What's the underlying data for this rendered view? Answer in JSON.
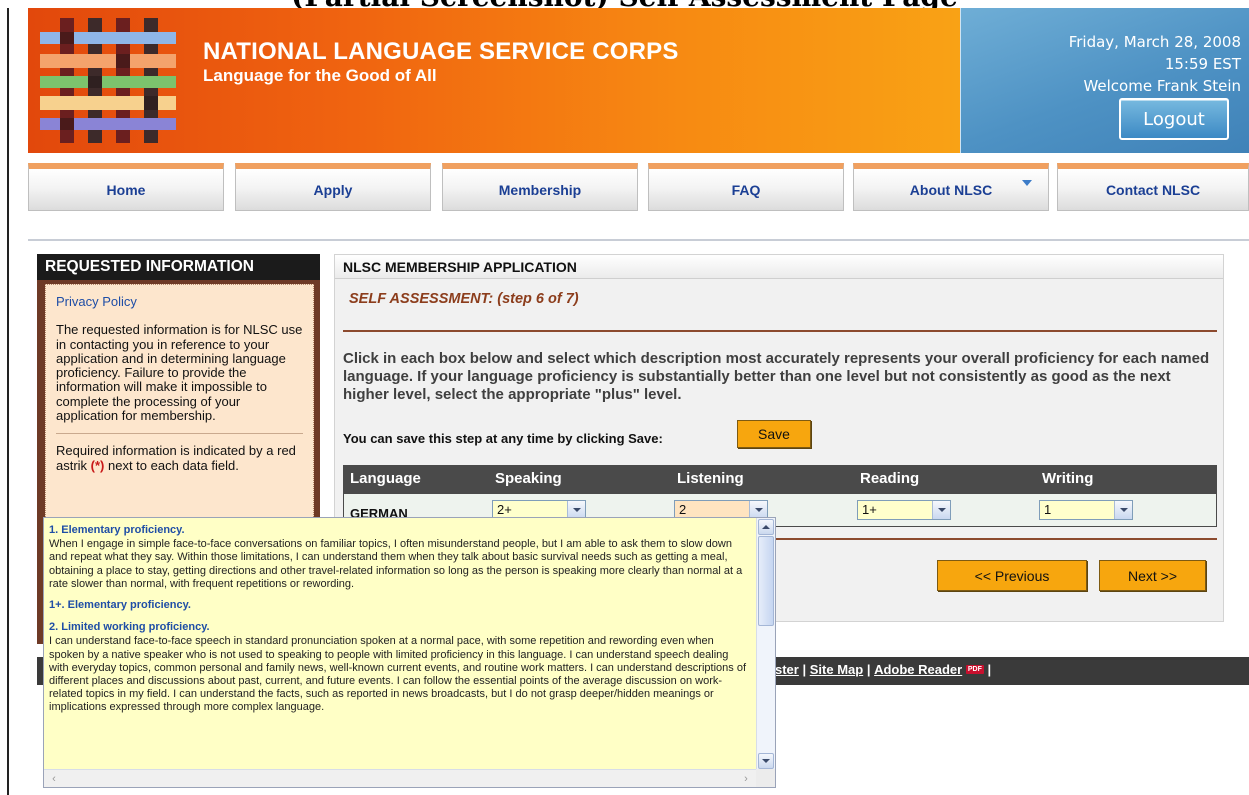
{
  "top_title": "(Partial Screenshot) Self Assessment Page",
  "header": {
    "title": "NATIONAL LANGUAGE SERVICE CORPS",
    "subtitle": "Language for the Good of All",
    "date": "Friday, March 28, 2008",
    "time": "15:59 EST",
    "welcome": "Welcome Frank Stein",
    "logout_label": "Logout",
    "colors": {
      "header_orange": "#f06410",
      "userbox_blue": "#4e92c4"
    }
  },
  "nav": {
    "items": [
      {
        "label": "Home"
      },
      {
        "label": "Apply"
      },
      {
        "label": "Membership"
      },
      {
        "label": "FAQ"
      },
      {
        "label": "About NLSC",
        "has_dropdown": true
      },
      {
        "label": "Contact NLSC"
      }
    ]
  },
  "sidebar": {
    "heading": "REQUESTED INFORMATION",
    "privacy_link": "Privacy Policy",
    "paragraph": "The requested information is for NLSC use in contacting you in reference to your application and in determining language proficiency. Failure to provide the information will make it impossible to complete the processing of your application for membership.",
    "required_text_before": "Required information is indicated by a red astrik ",
    "required_marker": "(*)",
    "required_text_after": " next to each data field."
  },
  "main": {
    "heading": "NLSC MEMBERSHIP APPLICATION",
    "step_title": "SELF ASSESSMENT: (step 6 of 7)",
    "instructions": "Click in each box below and select which description most accurately represents your overall proficiency for each named language. If your language proficiency is substantially better than one level but not consistently as good as the next higher level, select the appropriate \"plus\" level.",
    "save_prompt": "You can save this step at any time by clicking Save:",
    "save_label": "Save",
    "table": {
      "headers": [
        "Language",
        "Speaking",
        "Listening",
        "Reading",
        "Writing"
      ],
      "rows": [
        {
          "language": "GERMAN",
          "speaking": "2+",
          "listening": "2",
          "reading": "1+",
          "writing": "1"
        }
      ]
    },
    "prev_label": "<< Previous",
    "next_label": "Next >>"
  },
  "footer": {
    "links": [
      "ster",
      "Site Map",
      "Adobe Reader"
    ],
    "pdf_badge": "PDF"
  },
  "dropdown": {
    "options": [
      {
        "title": "1. Elementary proficiency.",
        "description": "When I engage in simple face-to-face conversations on familiar topics, I often misunderstand people, but I am able to ask them to slow down and repeat what they say. Within those limitations, I can understand them when they talk about basic survival needs such as getting a meal, obtaining a place to stay, getting directions and other travel-related information so long as the person is speaking more clearly than normal at a rate slower than normal, with frequent repetitions or rewording."
      },
      {
        "title": "1+. Elementary proficiency.",
        "description": ""
      },
      {
        "title": "2. Limited working proficiency.",
        "description": "I can understand face-to-face speech in standard pronunciation spoken at a normal pace, with some repetition and rewording even when spoken by a native speaker who is not used to speaking to people with limited proficiency in this language. I can understand speech dealing with everyday topics, common personal and family news, well-known current events, and routine work matters. I can understand descriptions of different places and discussions about past, current, and future events. I can follow the essential points of the average discussion on work-related topics in my field. I can understand the facts, such as reported in news broadcasts, but I do not grasp deeper/hidden meanings or implications expressed through more complex language."
      }
    ]
  }
}
